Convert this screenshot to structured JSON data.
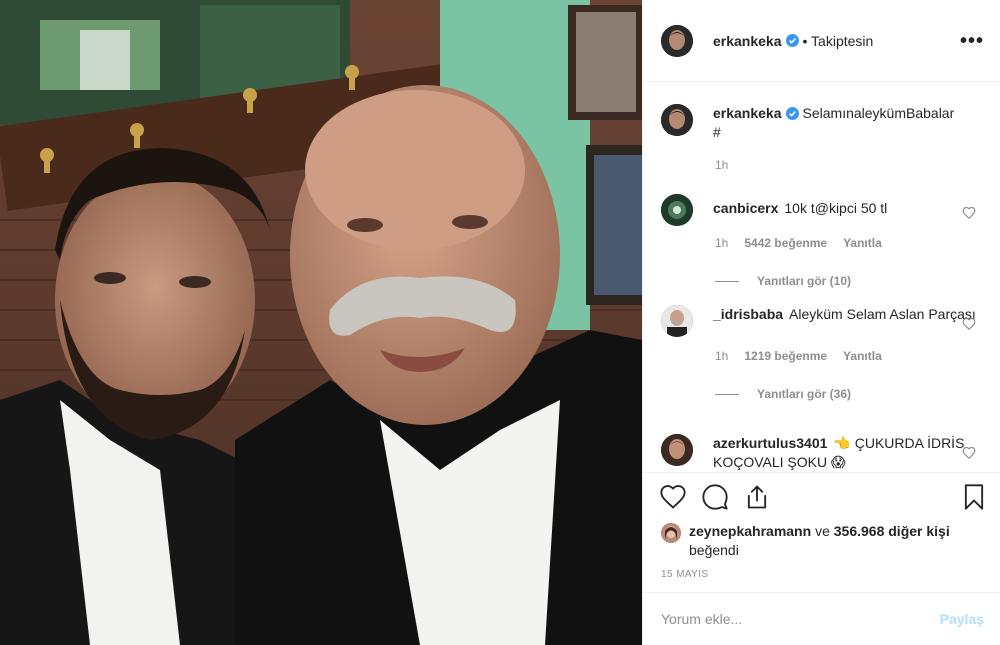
{
  "post": {
    "author": "erkankeka",
    "follow_status": "• Takiptesin",
    "more_menu": "•••"
  },
  "caption": {
    "username": "erkankeka",
    "text": "SelamınaleykümBabalar",
    "hashtag": "#",
    "time": "1h"
  },
  "comments": [
    {
      "username": "canbicerx",
      "text": "10k t@kipci 50 tl",
      "time": "1h",
      "likes": "5442 beğenme",
      "reply_label": "Yanıtla",
      "view_replies": "Yanıtları gör (10)"
    },
    {
      "username": "_idrisbaba",
      "text": "Aleyküm Selam Aslan Parçası",
      "time": "1h",
      "likes": "1219 beğenme",
      "reply_label": "Yanıtla",
      "view_replies": "Yanıtları gör (36)"
    },
    {
      "username": "azerkurtulus3401",
      "text": "👈 ÇUKURDA İDRİS KOÇOVALI ŞOKU 😱"
    }
  ],
  "likes": {
    "first_user": "zeynepkahramann",
    "connector": "ve",
    "others": "356.968 diğer kişi",
    "suffix": "beğendi"
  },
  "date": "15 MAYIS",
  "add_comment": {
    "placeholder": "Yorum ekle...",
    "post_label": "Paylaş"
  },
  "colors": {
    "verified": "#3897f0",
    "muted": "#8e8e8e",
    "post_disabled": "#b2dffc"
  },
  "icons": [
    "heart-icon",
    "comment-icon",
    "share-icon",
    "bookmark-icon",
    "verified-badge-icon",
    "more-icon"
  ]
}
